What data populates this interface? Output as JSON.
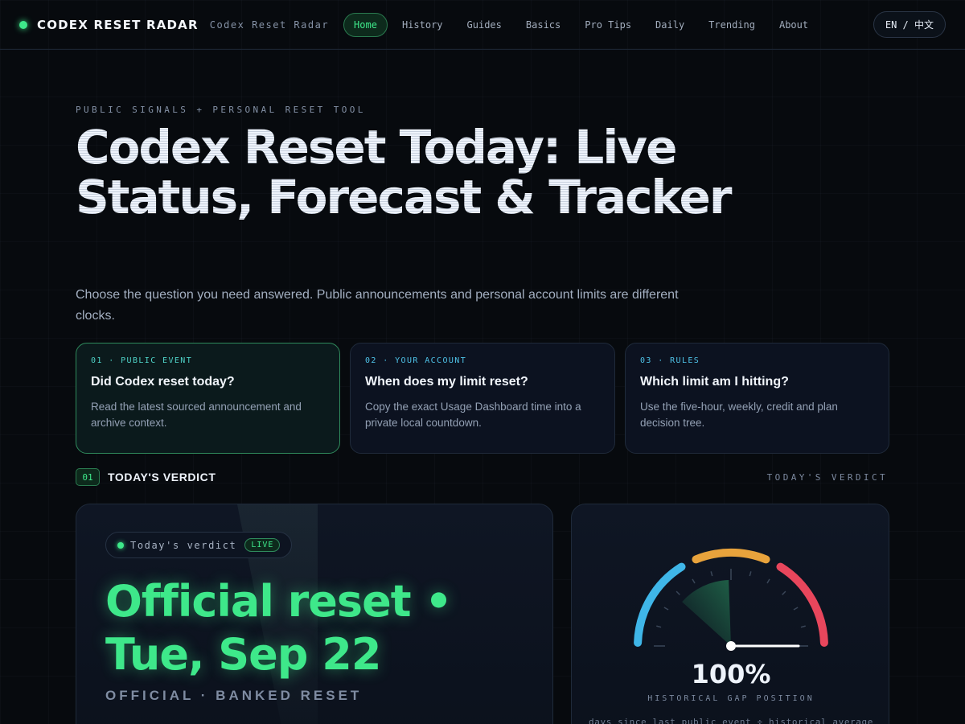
{
  "nav": {
    "brand": "CODEX RESET RADAR",
    "brand_sub": "Codex Reset Radar",
    "links": [
      "Home",
      "History",
      "Guides",
      "Basics",
      "Pro Tips",
      "Daily",
      "Trending",
      "About"
    ],
    "active": "Home",
    "lang": "EN / 中文"
  },
  "hero": {
    "eyebrow": "PUBLIC SIGNALS + PERSONAL RESET TOOL",
    "title": "Codex Reset Today: Live Status, Forecast & Tracker",
    "description": "Choose the question you need answered. Public announcements and personal account limits are different clocks."
  },
  "questions": [
    {
      "kicker": "01 · PUBLIC EVENT",
      "title": "Did Codex reset today?",
      "desc": "Read the latest sourced announcement and archive context."
    },
    {
      "kicker": "02 · YOUR ACCOUNT",
      "title": "When does my limit reset?",
      "desc": "Copy the exact Usage Dashboard time into a private local countdown."
    },
    {
      "kicker": "03 · RULES",
      "title": "Which limit am I hitting?",
      "desc": "Use the five-hour, weekly, credit and plan decision tree."
    }
  ],
  "section": {
    "number": "01",
    "title": "TODAY'S VERDICT",
    "right_label": "TODAY'S VERDICT"
  },
  "verdict": {
    "pill_text": "Today's verdict",
    "live_badge": "LIVE",
    "headline": "Official reset • Tue, Sep 22",
    "subline": "OFFICIAL · BANKED RESET"
  },
  "gauge": {
    "value_text": "100%",
    "value": 1.0,
    "label": "HISTORICAL GAP POSITION",
    "note": "days since last public event ÷ historical average",
    "colors": {
      "cool": "#3fb6e8",
      "mid": "#e8a33c",
      "hot": "#e8465c",
      "needle": "#ffffff",
      "sweep": "#3ee88a"
    }
  },
  "colors": {
    "accent": "#3ee88a",
    "background": "#070a0e",
    "card": "#0c1220"
  }
}
